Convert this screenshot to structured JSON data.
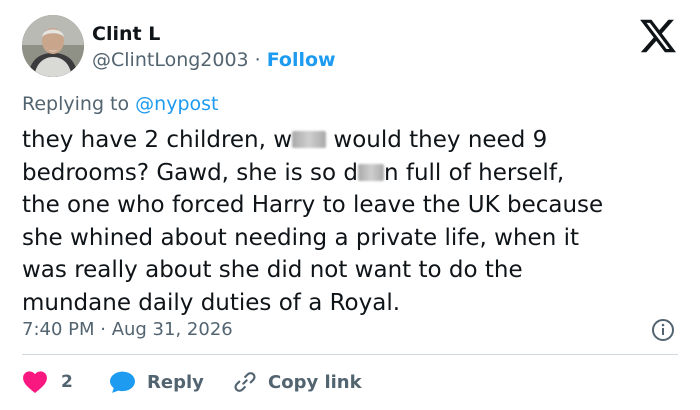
{
  "author": {
    "name": "Clint L",
    "handle": "@ClintLong2003",
    "separator": "·",
    "follow_label": "Follow"
  },
  "reply_context": {
    "prefix": "Replying to",
    "mention": "@nypost"
  },
  "tweet": {
    "lines": [
      [
        "they have 2 children, w",
        "",
        " would they need 9"
      ],
      [
        "bedrooms?  Gawd, she is so d",
        "",
        "n full of herself,"
      ],
      [
        "the one who forced Harry to leave the UK because"
      ],
      [
        "she whined about needing a private life, when it"
      ],
      [
        "was really about she did not want to do the"
      ],
      [
        "mundane daily duties of a Royal."
      ]
    ]
  },
  "meta": {
    "timestamp": "7:40 PM · Aug 31, 2026"
  },
  "actions": {
    "like_count": "2",
    "reply_label": "Reply",
    "copy_link_label": "Copy link"
  },
  "icons": {
    "logo": "x-logo-icon",
    "info": "info-icon",
    "like": "heart-icon",
    "reply": "reply-bubble-icon",
    "copy": "link-icon"
  },
  "colors": {
    "text": "#0f1419",
    "secondary": "#536471",
    "accent": "#1d9bf0",
    "like": "#f91880",
    "divider": "#cfd9de"
  }
}
